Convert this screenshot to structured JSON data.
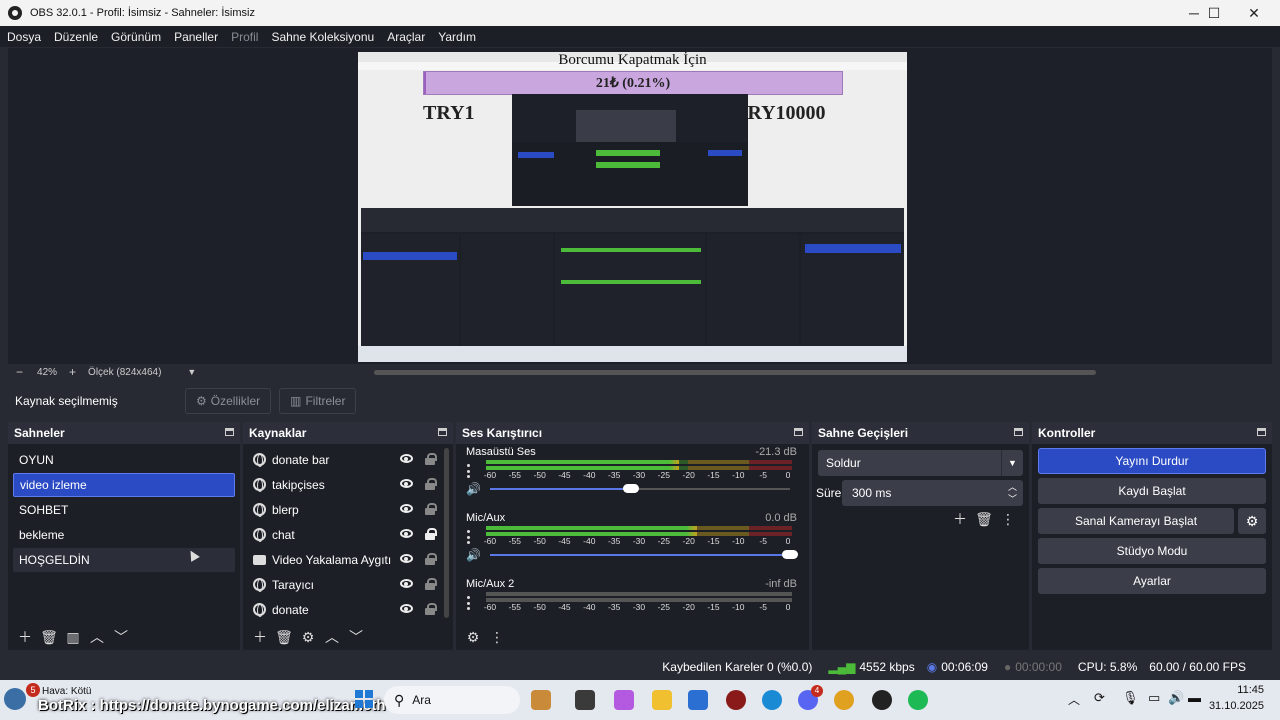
{
  "window": {
    "title": "OBS 32.0.1 - Profil: İsimsiz - Sahneler: İsimsiz",
    "min": "─",
    "max": "☐",
    "close": "✕"
  },
  "menu": [
    "Dosya",
    "Düzenle",
    "Görünüm",
    "Paneller",
    "Profil",
    "Sahne Koleksiyonu",
    "Araçlar",
    "Yardım"
  ],
  "preview": {
    "overlay_title": "Borcumu Kapatmak İçin",
    "progress_text": "21₺ (0.21%)",
    "progress_fraction": 0.0021,
    "left_label": "TRY1",
    "right_label": "TRY10000"
  },
  "zoom": {
    "minus": "−",
    "value": "42%",
    "plus": "+",
    "scale": "Ölçek (824x464)"
  },
  "source_bar": {
    "status": "Kaynak seçilmemiş",
    "properties": "Özellikler",
    "filters": "Filtreler"
  },
  "scenes": {
    "title": "Sahneler",
    "items": [
      "OYUN",
      "video izleme",
      "SOHBET",
      "bekleme",
      "HOŞGELDİN"
    ],
    "selected": 1
  },
  "sources": {
    "title": "Kaynaklar",
    "items": [
      {
        "name": "donate bar",
        "icon": "globe-icon",
        "locked": false
      },
      {
        "name": "takipçises",
        "icon": "globe-icon",
        "locked": false
      },
      {
        "name": "blerp",
        "icon": "globe-icon",
        "locked": false
      },
      {
        "name": "chat",
        "icon": "globe-icon",
        "locked": true
      },
      {
        "name": "Video Yakalama Aygıtı",
        "icon": "camera-icon",
        "locked": false
      },
      {
        "name": "Tarayıcı",
        "icon": "globe-icon",
        "locked": false
      },
      {
        "name": "donate",
        "icon": "globe-icon",
        "locked": false
      }
    ]
  },
  "mixer": {
    "title": "Ses Karıştırıcı",
    "scale": [
      "-60",
      "-55",
      "-50",
      "-45",
      "-40",
      "-35",
      "-30",
      "-25",
      "-20",
      "-15",
      "-10",
      "-5",
      "0"
    ],
    "channels": [
      {
        "name": "Masaüstü Ses",
        "db": "-21.3 dB",
        "level": 0.63,
        "volume": 0.47
      },
      {
        "name": "Mic/Aux",
        "db": "0.0 dB",
        "level": 0.69,
        "volume": 1.0
      },
      {
        "name": "Mic/Aux 2",
        "db": "-inf dB",
        "level": 0.0,
        "volume": 1.0
      }
    ]
  },
  "transitions": {
    "title": "Sahne Geçişleri",
    "selected": "Soldur",
    "duration_label": "Süre",
    "duration": "300 ms"
  },
  "controls": {
    "title": "Kontroller",
    "buttons": [
      "Yayını Durdur",
      "Kaydı Başlat",
      "Sanal Kamerayı Başlat",
      "Stüdyo Modu",
      "Ayarlar"
    ]
  },
  "status": {
    "dropped": "Kaybedilen Kareler 0 (%0.0)",
    "bitrate": "4552 kbps",
    "live_time": "00:06:09",
    "rec_time": "00:00:00",
    "cpu": "CPU: 5.8%",
    "fps": "60.00 / 60.00 FPS"
  },
  "taskbar": {
    "weather": "Hava: Kötü",
    "weather_badge": "5",
    "ticker": "BotRix : https://donate.bynogame.com/elizameth",
    "search": "Ara",
    "time": "11:45",
    "date": "31.10.2025",
    "badge": "4"
  },
  "colors": {
    "accent": "#2b4bc5",
    "meter_green": "#4cbb3a",
    "meter_yellow": "#c7a11e",
    "meter_red": "#c0353a",
    "overlay_bar": "#c9a6dd"
  }
}
